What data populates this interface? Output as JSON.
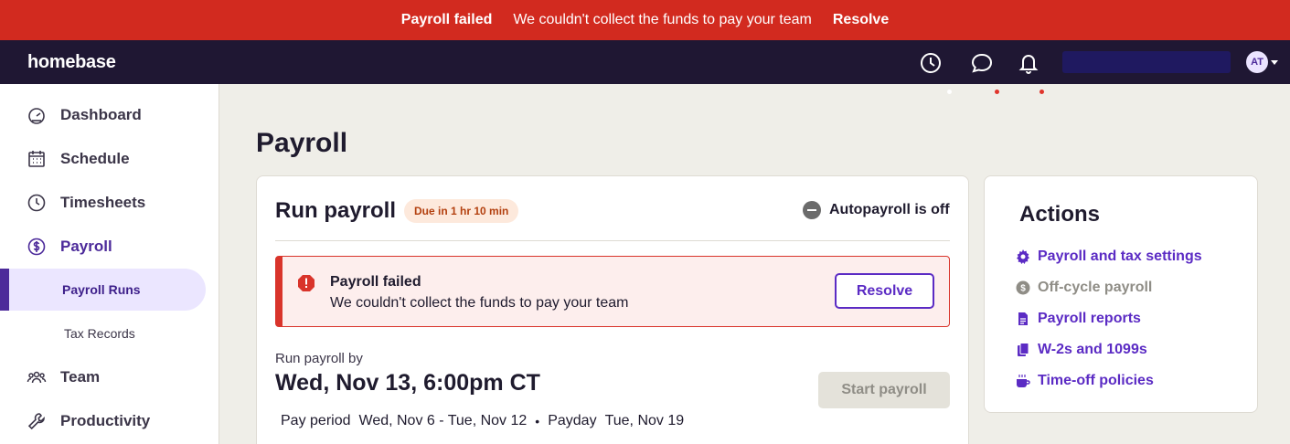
{
  "banner": {
    "title": "Payroll failed",
    "message": "We couldn't collect the funds to pay your team",
    "action": "Resolve"
  },
  "header": {
    "logo": "homebase",
    "icons": [
      "clock-icon",
      "chat-icon",
      "bell-icon"
    ],
    "avatar_initials": "AT"
  },
  "sidebar": {
    "items": [
      {
        "label": "Dashboard",
        "icon": "dashboard-icon"
      },
      {
        "label": "Schedule",
        "icon": "calendar-icon"
      },
      {
        "label": "Timesheets",
        "icon": "clock-icon"
      },
      {
        "label": "Payroll",
        "icon": "dollar-icon"
      },
      {
        "label": "Team",
        "icon": "team-icon"
      },
      {
        "label": "Productivity",
        "icon": "wrench-icon"
      }
    ],
    "payroll_sub": [
      {
        "label": "Payroll Runs"
      },
      {
        "label": "Tax Records"
      }
    ]
  },
  "main": {
    "page_title": "Payroll",
    "run_card": {
      "title": "Run payroll",
      "due_badge": "Due in 1 hr 10 min",
      "autopayroll": "Autopayroll is off",
      "alert": {
        "title": "Payroll failed",
        "message": "We couldn't collect the funds to pay your team",
        "action": "Resolve"
      },
      "run_by_label": "Run payroll by",
      "run_by_date": "Wed, Nov 13, 6:00pm CT",
      "start_button": "Start payroll",
      "pay_period_label": "Pay period",
      "pay_period_value": "Wed, Nov 6 - Tue, Nov 12",
      "separator": "•",
      "payday_label": "Payday",
      "payday_value": "Tue, Nov 19"
    },
    "actions": {
      "title": "Actions",
      "items": [
        {
          "label": "Payroll and tax settings",
          "icon": "gear-icon",
          "enabled": true
        },
        {
          "label": "Off-cycle payroll",
          "icon": "dollar-coin-icon",
          "enabled": false
        },
        {
          "label": "Payroll reports",
          "icon": "document-icon",
          "enabled": true
        },
        {
          "label": "W-2s and 1099s",
          "icon": "copy-document-icon",
          "enabled": true
        },
        {
          "label": "Time-off policies",
          "icon": "mug-icon",
          "enabled": true
        }
      ]
    }
  },
  "colors": {
    "banner_red": "#d22a1f",
    "header_bg": "#1f1733",
    "brand_purple": "#5b2bc4",
    "active_nav_bg": "#ebe6ff",
    "page_bg": "#efeee8"
  }
}
